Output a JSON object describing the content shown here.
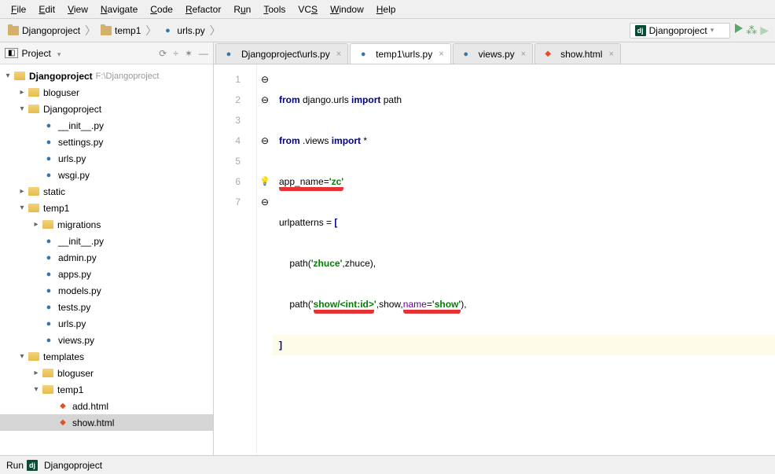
{
  "menu": {
    "file": "File",
    "edit": "Edit",
    "view": "View",
    "navigate": "Navigate",
    "code": "Code",
    "refactor": "Refactor",
    "run": "Run",
    "tools": "Tools",
    "vcs": "VCS",
    "window": "Window",
    "help": "Help"
  },
  "breadcrumb": {
    "p1": "Djangoproject",
    "p2": "temp1",
    "p3": "urls.py"
  },
  "runconfig": "Djangoproject",
  "sidebar": {
    "title": "Project",
    "tools": {
      "sync": "⟳",
      "collapse": "÷",
      "gear": "✶",
      "hide": "—"
    }
  },
  "tree": {
    "root": {
      "name": "Djangoproject",
      "path": "F:\\Djangoproject"
    },
    "bloguser": "bloguser",
    "djangoproject": "Djangoproject",
    "initpy": "__init__.py",
    "settings": "settings.py",
    "urls": "urls.py",
    "wsgi": "wsgi.py",
    "static": "static",
    "temp1": "temp1",
    "migrations": "migrations",
    "initpy2": "__init__.py",
    "admin": "admin.py",
    "apps": "apps.py",
    "models": "models.py",
    "tests": "tests.py",
    "urls2": "urls.py",
    "views": "views.py",
    "templates": "templates",
    "bloguser2": "bloguser",
    "temp1b": "temp1",
    "addhtml": "add.html",
    "showhtml": "show.html"
  },
  "tabs": {
    "t1": "Djangoproject\\urls.py",
    "t2": "temp1\\urls.py",
    "t3": "views.py",
    "t4": "show.html"
  },
  "code": {
    "l1a": "from",
    "l1b": " django.urls ",
    "l1c": "import",
    "l1d": " path",
    "l2a": "from",
    "l2b": " .views ",
    "l2c": "import",
    "l2d": " *",
    "l3a": "app_name=",
    "l3b": "'",
    "l3c": "zc",
    "l3d": "'",
    "l4a": "urlpatterns = ",
    "l4b": "[",
    "l5a": "    path(",
    "l5b": "'",
    "l5c": "zhuce",
    "l5d": "'",
    "l5e": ",zhuce),",
    "l6a": "    path(",
    "l6b": "'",
    "l6c": "show/<int:id>",
    "l6d": "'",
    "l6e": ",show,",
    "l6f": "name",
    "l6g": "=",
    "l6h": "'",
    "l6i": "show",
    "l6j": "'",
    "l6k": "),",
    "l7": "]"
  },
  "lines": {
    "1": "1",
    "2": "2",
    "3": "3",
    "4": "4",
    "5": "5",
    "6": "6",
    "7": "7"
  },
  "status": {
    "run": "Run",
    "proj": "Djangoproject"
  }
}
